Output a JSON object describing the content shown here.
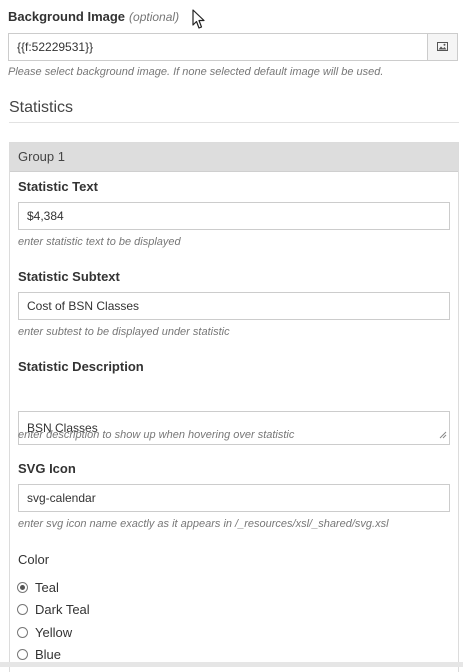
{
  "background_image": {
    "label": "Background Image",
    "optional": "(optional)",
    "value": "{{f:52229531}}",
    "help": "Please select background image. If none selected default image will be used."
  },
  "section": {
    "title": "Statistics"
  },
  "group": {
    "title": "Group 1",
    "statistic_text": {
      "label": "Statistic Text",
      "value": "$4,384",
      "help": "enter statistic text to be displayed"
    },
    "statistic_subtext": {
      "label": "Statistic Subtext",
      "value": "Cost of BSN Classes",
      "help": "enter subtest to be displayed under statistic"
    },
    "statistic_description": {
      "label": "Statistic Description",
      "value": "BSN Classes",
      "help": "enter description to show up when hovering over statistic"
    },
    "svg_icon": {
      "label": "SVG Icon",
      "value": "svg-calendar",
      "help": "enter svg icon name exactly as it appears in /_resources/xsl/_shared/svg.xsl"
    },
    "color": {
      "label": "Color",
      "options": [
        "Teal",
        "Dark Teal",
        "Yellow",
        "Blue"
      ],
      "selected": "Teal"
    }
  },
  "icons": {
    "cursor": "mouse-pointer-icon",
    "image_button": "image-icon",
    "resize": "resize-grip-icon"
  }
}
